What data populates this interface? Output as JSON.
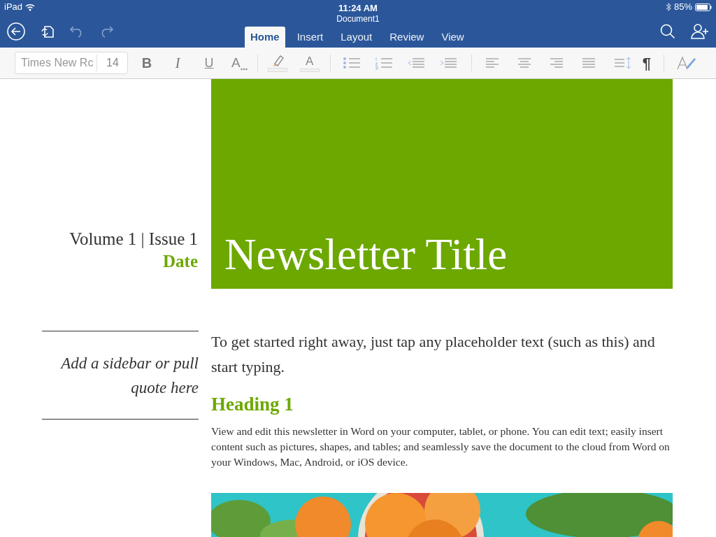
{
  "status_bar": {
    "device": "iPad",
    "time": "11:24 AM",
    "battery": "85%"
  },
  "window": {
    "title": "Document1"
  },
  "tabs": [
    {
      "label": "Home",
      "selected": true
    },
    {
      "label": "Insert",
      "selected": false
    },
    {
      "label": "Layout",
      "selected": false
    },
    {
      "label": "Review",
      "selected": false
    },
    {
      "label": "View",
      "selected": false
    }
  ],
  "ribbon": {
    "font": "Times New Rc",
    "size": "14",
    "bold": "B",
    "italic": "I",
    "underline": "U",
    "styles": "A",
    "font_color": "A",
    "paragraph_marks": "¶"
  },
  "document": {
    "volume": "Volume 1 | Issue 1",
    "date": "Date",
    "title": "Newsletter Title",
    "sidebar": "Add a sidebar or pull quote here",
    "intro": "To get started right away, just tap any placeholder text (such as this) and start typing.",
    "heading": "Heading 1",
    "body": "View and edit this newsletter in Word on your computer, tablet, or phone. You can edit text; easily insert content such as pictures, shapes, and tables; and seamlessly save the document to the cloud from Word on your Windows, Mac, Android, or iOS device."
  }
}
